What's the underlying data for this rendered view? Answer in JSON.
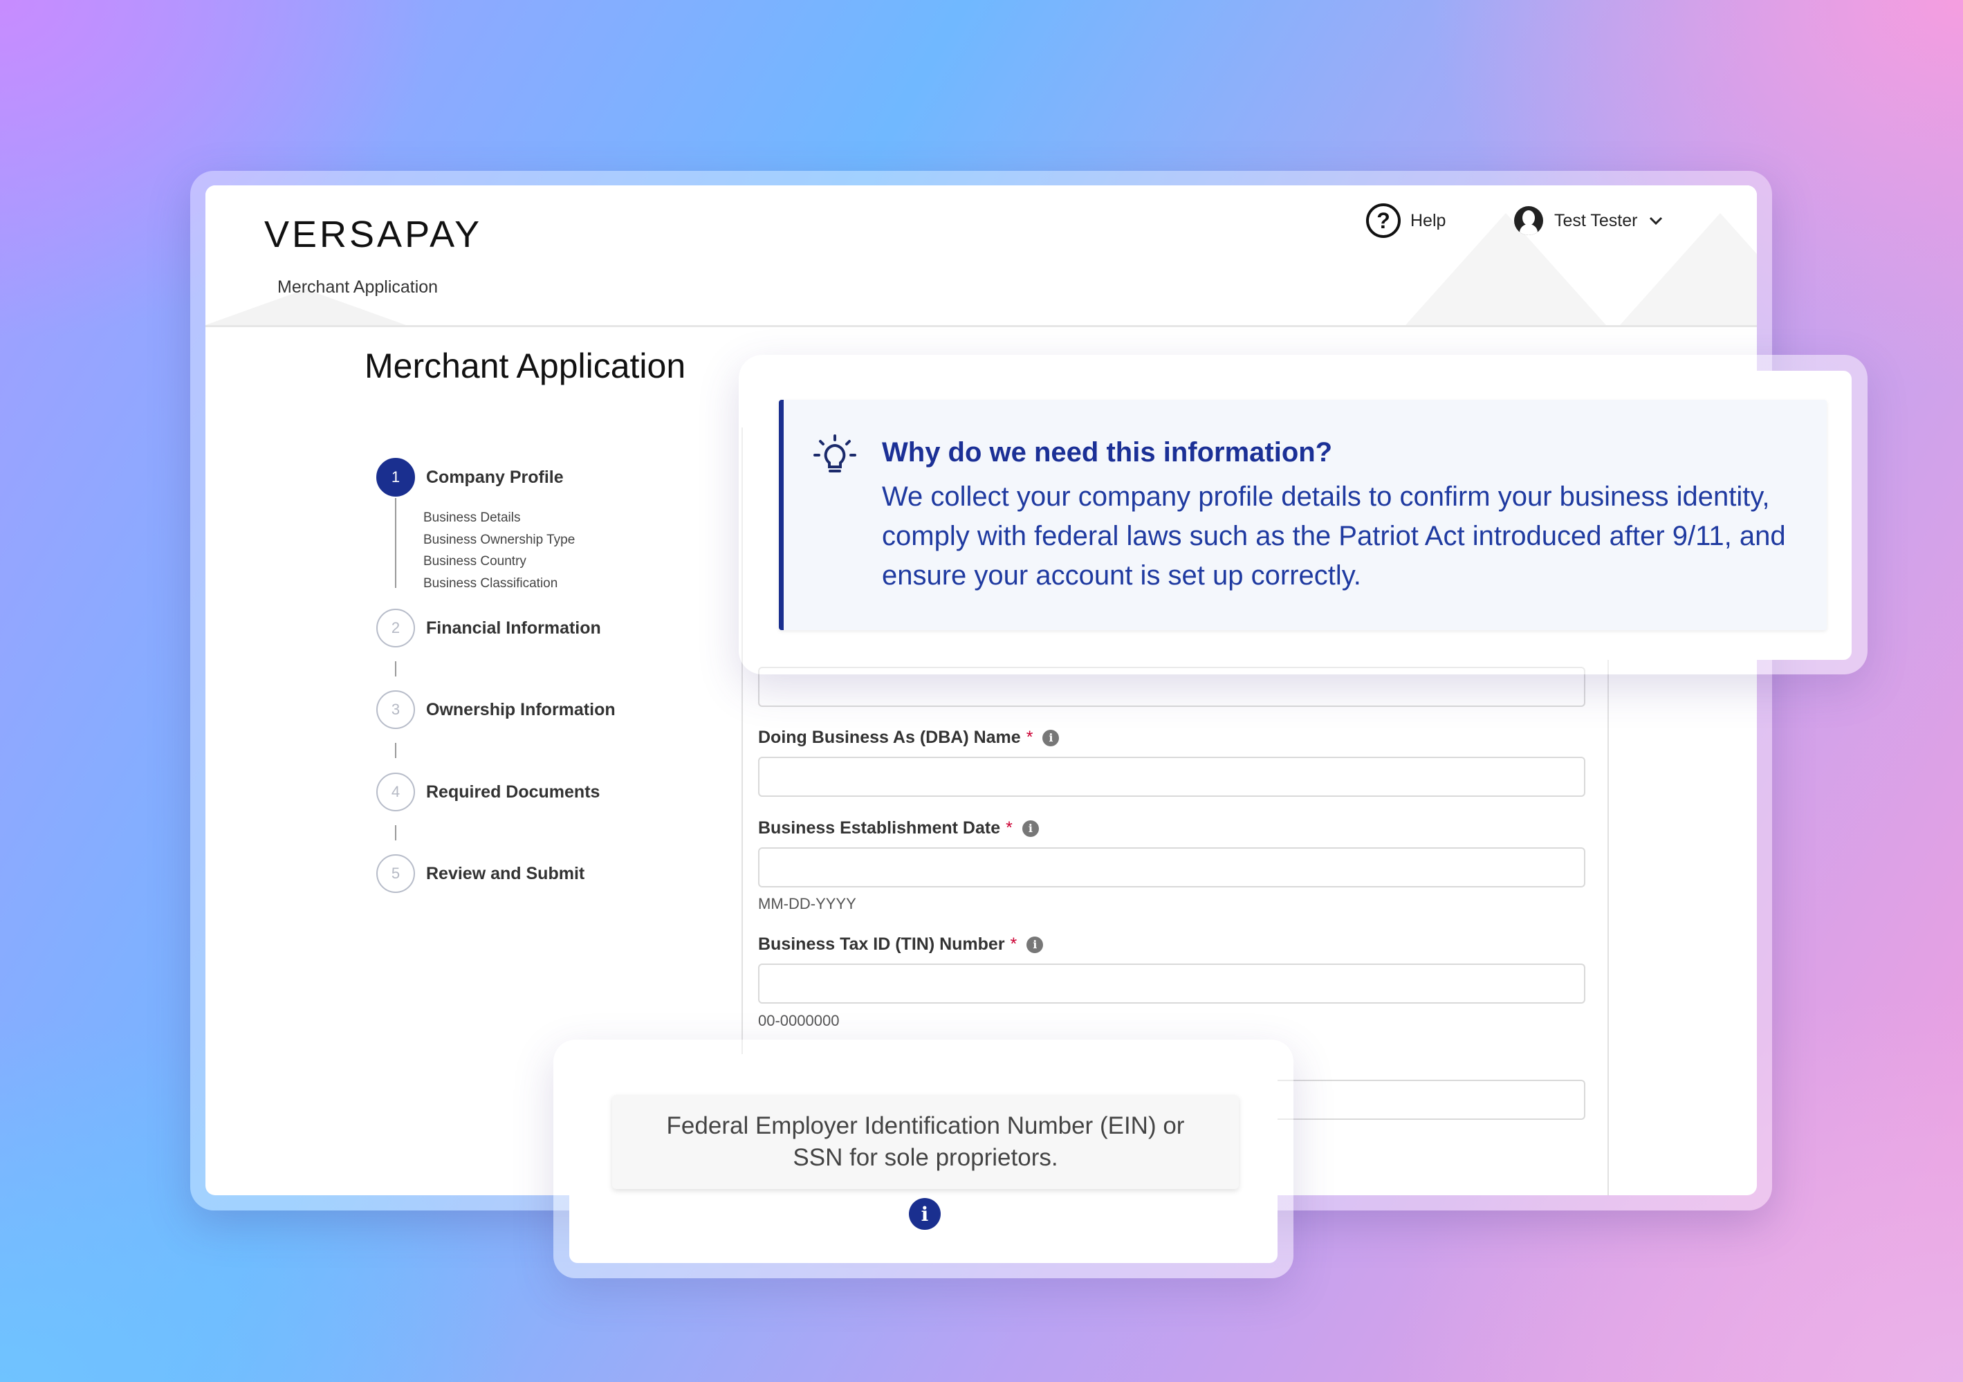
{
  "app": {
    "logo": "VERSAPAY",
    "subnav": "Merchant Application",
    "help_label": "Help",
    "user_name": "Test Tester"
  },
  "page": {
    "title": "Merchant Application"
  },
  "steps": [
    {
      "number": "1",
      "label": "Company Profile",
      "active": true,
      "substeps": [
        "Business Details",
        "Business Ownership Type",
        "Business Country",
        "Business Classification"
      ]
    },
    {
      "number": "2",
      "label": "Financial Information"
    },
    {
      "number": "3",
      "label": "Ownership Information"
    },
    {
      "number": "4",
      "label": "Required Documents"
    },
    {
      "number": "5",
      "label": "Review and Submit"
    }
  ],
  "form": {
    "dba": {
      "label": "Doing Business As (DBA) Name",
      "value": ""
    },
    "establishment": {
      "label": "Business Establishment Date",
      "value": "",
      "hint": "MM-DD-YYYY"
    },
    "tin": {
      "label": "Business Tax ID (TIN) Number",
      "value": "",
      "hint": "00-0000000"
    },
    "required_marker": "*"
  },
  "callout": {
    "title": "Why do we need this information?",
    "body": "We collect your company profile details to confirm your business identity, comply with federal laws such as the Patriot Act introduced after 9/11, and ensure your account is set up correctly."
  },
  "tooltip": {
    "text": "Federal Employer Identification Number (EIN) or SSN for sole proprietors."
  },
  "colors": {
    "accent": "#1a2f8f",
    "callout_text": "#1f3aa0",
    "required": "#cc0033"
  }
}
